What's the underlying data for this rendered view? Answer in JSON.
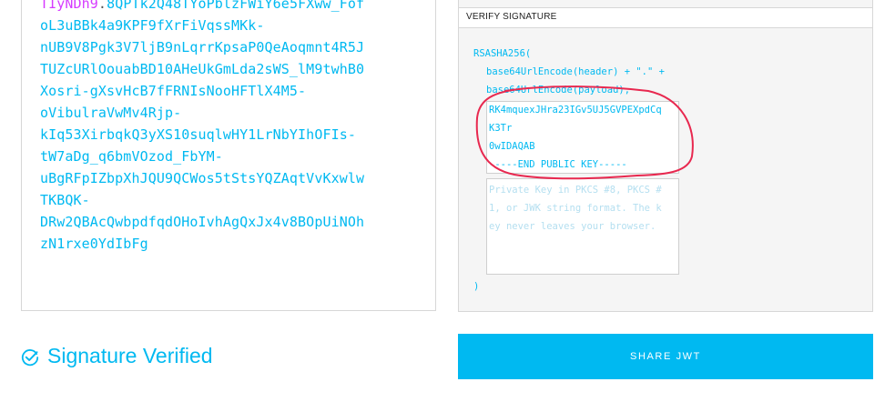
{
  "token": {
    "lines": [
      {
        "purple": "TIyNDh9",
        "dot": ".",
        "rest": "8QPTk2Q48TYoPblzFWiY6e5FXww_Fof"
      },
      "oL3uBBk4a9KPF9fXrFiVqssMKk-",
      "nUB9V8Pgk3V7ljB9nLqrrKpsaP0QeAoqmnt4R5J",
      "TUZcURlOouabBD10AHeUkGmLda2sWS_lM9twhB0",
      "Xosri-gXsvHcB7fFRNIsNooHFTlX4M5-",
      "oVibulraVwMv4Rjp-",
      "kIq53XirbqkQ3yXS10suqlwHY1LrNbYIhOFIs-",
      "tW7aDg_q6bmVOzod_FbYM-",
      "uBgRFpIZbpXhJQU9QCWos5tStsYQZAqtVvKxwlw",
      "TKBQK-",
      "DRw2QBAcQwbpdfqdOHoIvhAgQxJx4v8BOpUiNOh",
      "zN1rxe0YdIbFg"
    ]
  },
  "verify": {
    "title": "VERIFY SIGNATURE",
    "code": [
      "RSASHA256(",
      "base64UrlEncode(header) + \".\" +",
      "base64UrlEncode(payload),"
    ],
    "closing": ")",
    "public_key_lines": [
      "RK4mquexJHra23IGv5UJ5GVPEXpdCq",
      "K3Tr",
      "0wIDAQAB",
      "-----END PUBLIC KEY-----"
    ],
    "private_key_placeholder_lines": [
      "Private Key in PKCS #8, PKCS #",
      "1, or JWK string format. The k",
      "ey never leaves your browser."
    ]
  },
  "status": {
    "text": "Signature Verified",
    "icon": "check-circle-icon",
    "color": "#00b9f1"
  },
  "share_button": {
    "label": "SHARE JWT"
  },
  "annotation": {
    "shape": "hand-drawn circle",
    "color": "#e8284f"
  }
}
